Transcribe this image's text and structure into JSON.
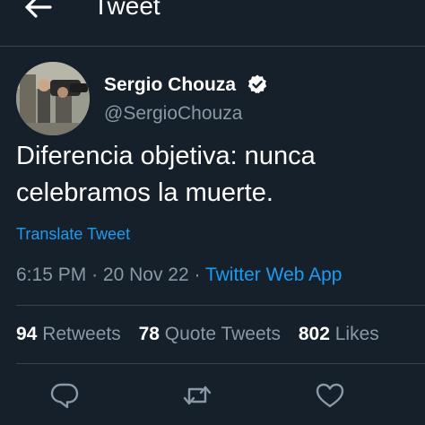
{
  "header": {
    "back_icon": "arrow-left-icon",
    "title": "Tweet"
  },
  "tweet": {
    "author": {
      "name": "Sergio Chouza",
      "handle": "@SergioChouza",
      "verified_icon": "verified-badge-icon"
    },
    "text_lines": [
      "Diferencia objetiva: nunca",
      "celebramos la muerte."
    ],
    "translate_label": "Translate Tweet",
    "time": "6:15 PM",
    "date": "20 Nov 22",
    "separator": "·",
    "source": "Twitter Web App"
  },
  "stats": {
    "retweets": {
      "count": "94",
      "label": "Retweets"
    },
    "quotes": {
      "count": "78",
      "label": "Quote Tweets"
    },
    "likes": {
      "count": "802",
      "label": "Likes"
    }
  },
  "actions": [
    "reply-icon",
    "retweet-icon",
    "like-icon"
  ],
  "colors": {
    "background": "#15202b",
    "text": "#ffffff",
    "secondary": "#8b98a5",
    "accent": "#1d9bf0",
    "divider": "#38444d"
  }
}
